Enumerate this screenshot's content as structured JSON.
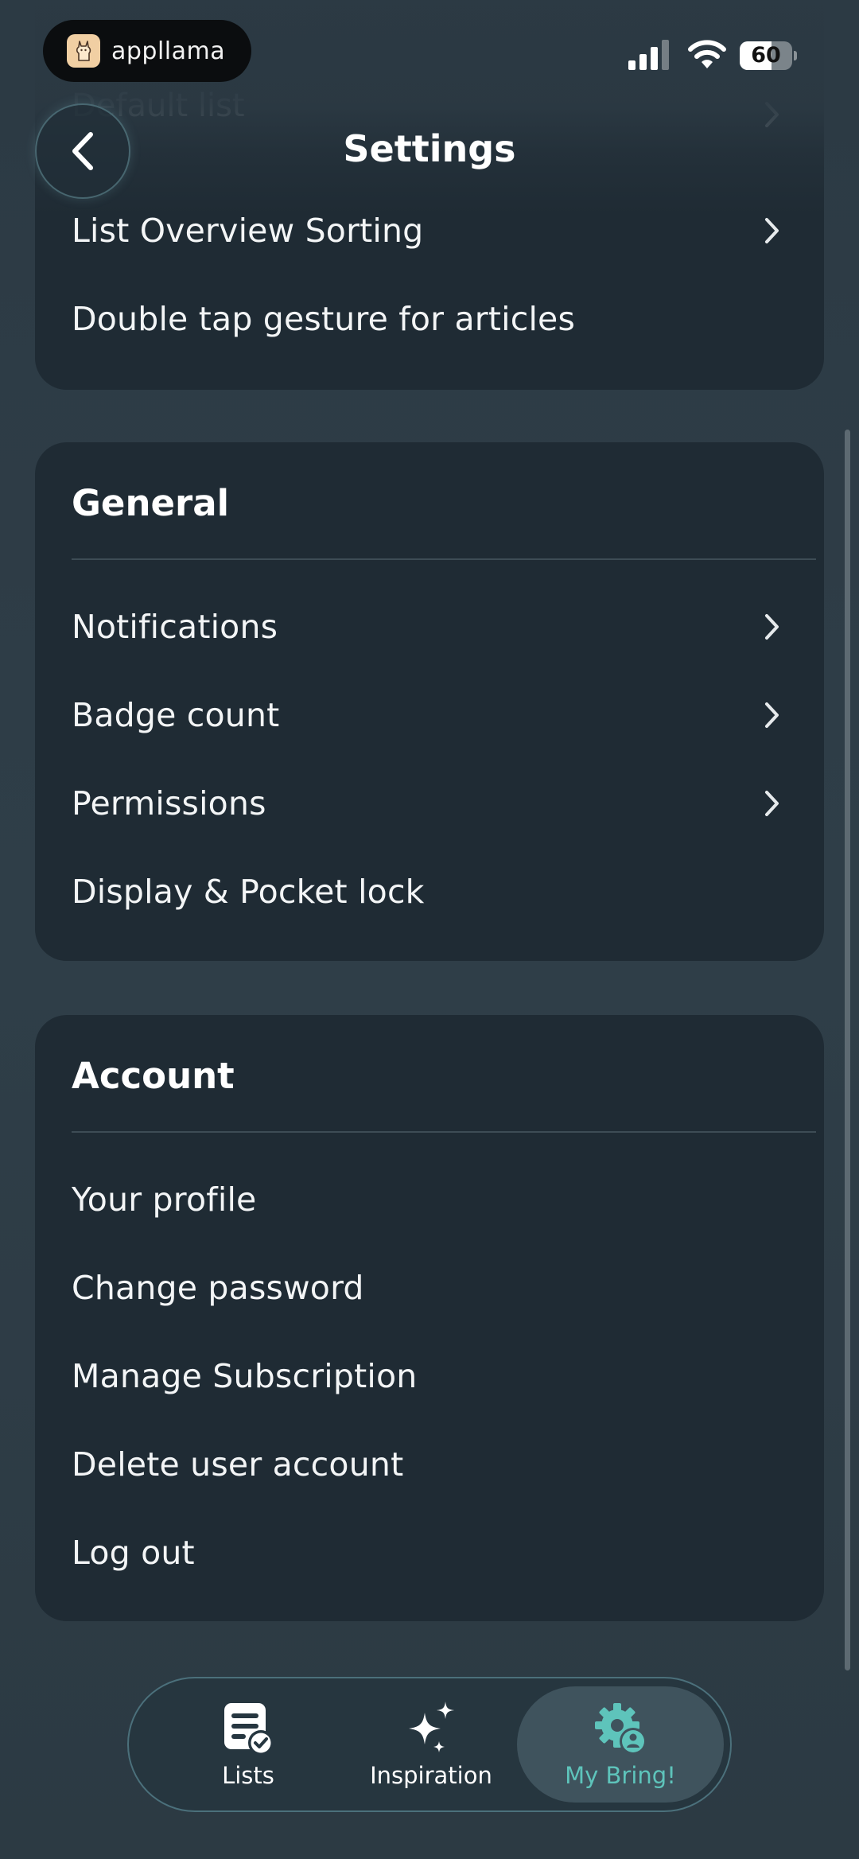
{
  "status_bar": {
    "brand": "appllama",
    "battery_level": "60",
    "battery_fraction": 0.6
  },
  "header": {
    "title": "Settings",
    "back_icon": "chevron-left-icon"
  },
  "top_section": {
    "ghost_items": [
      "Default list"
    ],
    "items": [
      {
        "label": "List Overview Sorting",
        "has_chevron": true
      },
      {
        "label": "Double tap gesture for articles",
        "has_chevron": false
      }
    ]
  },
  "general": {
    "title": "General",
    "items": [
      {
        "label": "Notifications",
        "has_chevron": true
      },
      {
        "label": "Badge count",
        "has_chevron": true
      },
      {
        "label": "Permissions",
        "has_chevron": true
      },
      {
        "label": "Display & Pocket lock",
        "has_chevron": false
      }
    ]
  },
  "account": {
    "title": "Account",
    "items": [
      {
        "label": "Your profile"
      },
      {
        "label": "Change password"
      },
      {
        "label": "Manage Subscription"
      },
      {
        "label": "Delete user account"
      },
      {
        "label": "Log out"
      }
    ]
  },
  "tab_bar": {
    "tabs": [
      {
        "label": "Lists",
        "icon": "list-check-icon",
        "active": false
      },
      {
        "label": "Inspiration",
        "icon": "sparkles-icon",
        "active": false
      },
      {
        "label": "My Bring!",
        "icon": "gear-user-icon",
        "active": true
      }
    ]
  },
  "colors": {
    "background": "#2c3a44",
    "card": "#1f2b34",
    "accent": "#5ec4bb",
    "text": "#ffffff"
  }
}
